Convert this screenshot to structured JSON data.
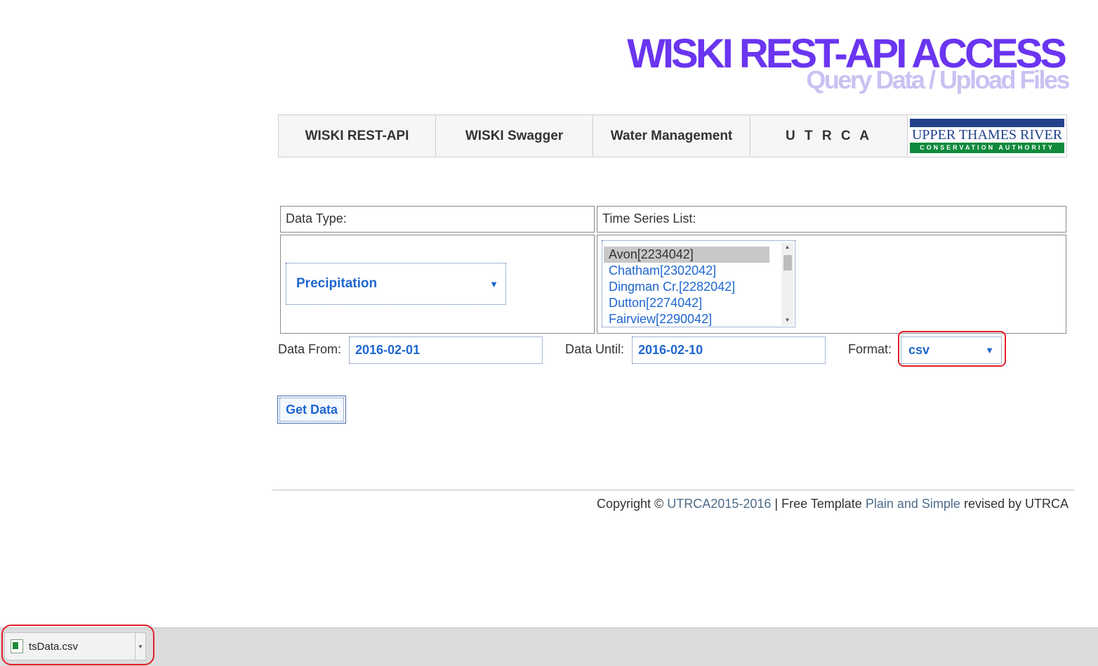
{
  "header": {
    "title": "WISKI REST-API ACCESS",
    "subtitle": "Query Data / Upload Files"
  },
  "nav": {
    "items": [
      "WISKI REST-API",
      "WISKI Swagger",
      "Water Management",
      "U T R C A"
    ],
    "logo": {
      "line1": "UPPER THAMES RIVER",
      "line2": "CONSERVATION AUTHORITY"
    }
  },
  "form": {
    "data_type_label": "Data Type:",
    "data_type_value": "Precipitation",
    "time_series_label": "Time Series List:",
    "time_series_items": [
      "Avon[2234042]",
      "Chatham[2302042]",
      "Dingman Cr.[2282042]",
      "Dutton[2274042]",
      "Fairview[2290042]"
    ],
    "data_from_label": "Data From:",
    "data_from_value": "2016-02-01",
    "data_until_label": "Data Until:",
    "data_until_value": "2016-02-10",
    "format_label": "Format:",
    "format_value": "csv",
    "submit_label": "Get Data"
  },
  "footer": {
    "copyright": "Copyright ©",
    "org_years": "UTRCA2015-2016",
    "separator": "|",
    "free_template": "Free Template",
    "template_name": "Plain and Simple",
    "revised_by": "revised by UTRCA"
  },
  "download_bar": {
    "file_name": "tsData.csv"
  },
  "colors": {
    "title": "#6a35f0",
    "subtitle": "#c9c2f2",
    "link_blue": "#1e66d0",
    "annotation_red": "#e0202a"
  }
}
